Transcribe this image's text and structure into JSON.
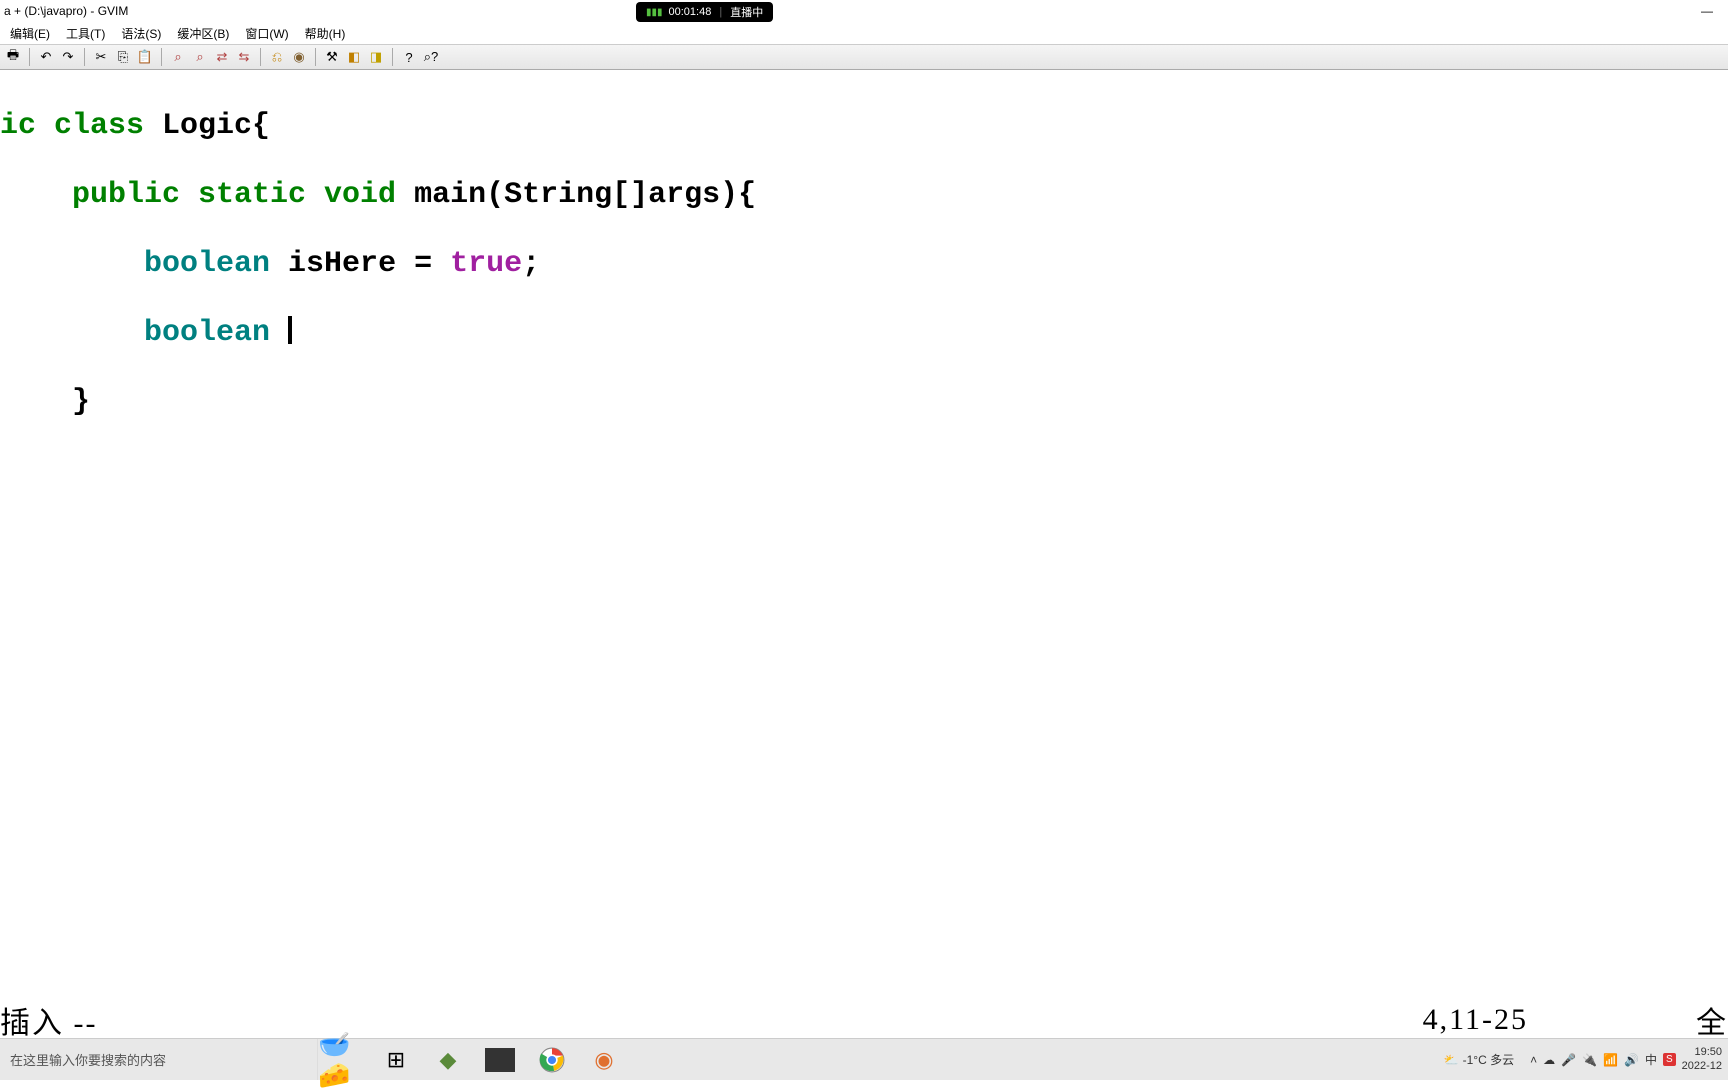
{
  "window": {
    "title": "a + (D:\\javapro) - GVIM",
    "minimize": "—"
  },
  "stream": {
    "time": "00:01:48",
    "label": "直播中"
  },
  "menu": {
    "edit": "编辑(E)",
    "tools": "工具(T)",
    "syntax": "语法(S)",
    "buffers": "缓冲区(B)",
    "window": "窗口(W)",
    "help": "帮助(H)"
  },
  "code": {
    "l1_a": "ic class",
    "l1_b": " Logic{",
    "l2_a": "    public static void",
    "l2_b": " main(String[]args){",
    "l3_a": "        boolean",
    "l3_b": " isHere = ",
    "l3_c": "true",
    "l3_d": ";",
    "l4_a": "        boolean",
    "l4_b": " ",
    "l5": "    }"
  },
  "status": {
    "mode": "插入 --",
    "position": "4,11-25",
    "extent": "全"
  },
  "taskbar": {
    "search_placeholder": "在这里输入你要搜索的内容",
    "weather_temp": "-1°C 多云",
    "time": "19:50",
    "date": "2022-12"
  }
}
